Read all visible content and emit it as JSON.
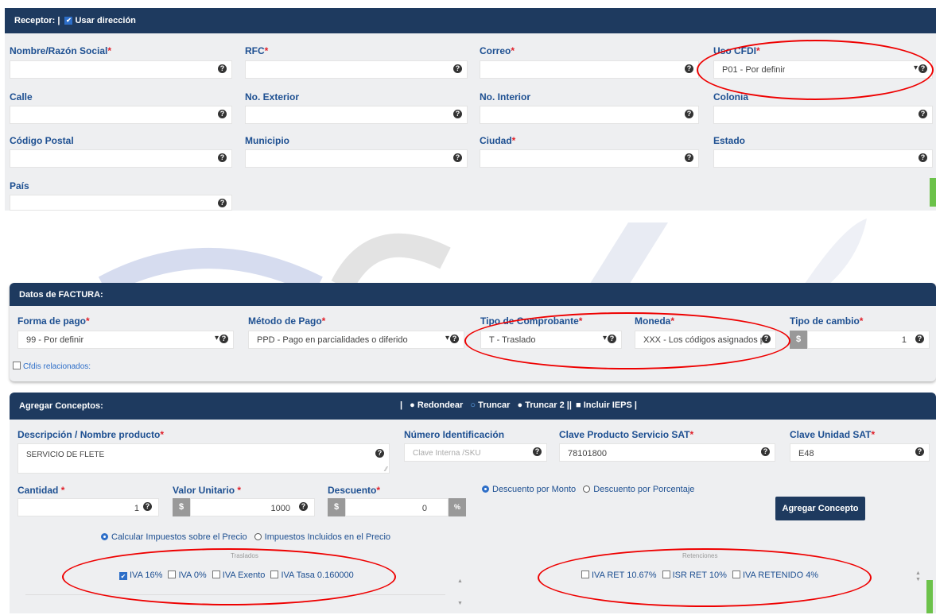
{
  "receptor": {
    "header_label": "Receptor: |",
    "usar_direccion_label": "Usar dirección",
    "fields": {
      "nombre": "Nombre/Razón Social",
      "rfc": "RFC",
      "correo": "Correo",
      "uso_cfdi": "Uso CFDI",
      "uso_cfdi_value": "P01 - Por definir",
      "calle": "Calle",
      "no_exterior": "No. Exterior",
      "no_interior": "No. Interior",
      "colonia": "Colonia",
      "codigo_postal": "Código Postal",
      "municipio": "Municipio",
      "ciudad": "Ciudad",
      "estado": "Estado",
      "pais": "País"
    }
  },
  "factura": {
    "header_label": "Datos de FACTURA:",
    "forma_pago_label": "Forma de pago",
    "forma_pago_value": "99 - Por definir",
    "metodo_pago_label": "Método de Pago",
    "metodo_pago_value": "PPD - Pago en parcialidades o diferido",
    "tipo_comprobante_label": "Tipo de Comprobante",
    "tipo_comprobante_value": "T - Traslado",
    "moneda_label": "Moneda",
    "moneda_value": "XXX - Los códigos asignados para",
    "tipo_cambio_label": "Tipo de cambio",
    "tipo_cambio_value": "1",
    "cfdis_label": "Cfdis relacionados:"
  },
  "conceptos": {
    "header_label": "Agregar Conceptos:",
    "rounding": {
      "sep": "|",
      "redondear": "Redondear",
      "truncar": "Truncar",
      "truncar2": "Truncar 2 ||",
      "ieps": "Incluir IEPS |"
    },
    "descripcion_label": "Descripción / Nombre producto",
    "descripcion_value": "SERVICIO DE FLETE",
    "numero_id_label": "Número Identificación",
    "numero_id_placeholder": "Clave Interna /SKU",
    "clave_prod_label": "Clave Producto Servicio SAT",
    "clave_prod_value": "78101800",
    "clave_unidad_label": "Clave Unidad SAT",
    "clave_unidad_value": "E48",
    "cantidad_label": "Cantidad",
    "cantidad_value": "1",
    "valor_unitario_label": "Valor Unitario",
    "valor_unitario_value": "1000",
    "descuento_label": "Descuento",
    "descuento_value": "0",
    "descuento_monto": "Descuento por Monto",
    "descuento_porcentaje": "Descuento por Porcentaje",
    "agregar_btn": "Agregar Concepto",
    "calcular_precio": "Calcular Impuestos sobre el Precio",
    "incluidos_precio": "Impuestos Incluidos en el Precio",
    "traslados_title": "Traslados",
    "traslados": [
      "IVA 16%",
      "IVA 0%",
      "IVA Exento",
      "IVA Tasa 0.160000"
    ],
    "retenciones_title": "Retenciones",
    "retenciones": [
      "IVA RET 10.67%",
      "ISR RET 10%",
      "IVA RETENIDO 4%"
    ]
  },
  "symbols": {
    "question": "?",
    "dollar": "$",
    "percent": "%",
    "asterisk": "*",
    "check": "✔"
  },
  "colors": {
    "header": "#1e3a5f",
    "label": "#1d4f91",
    "required": "#e0202a",
    "annotation": "#e00000",
    "accent_green": "#6cc24a"
  }
}
